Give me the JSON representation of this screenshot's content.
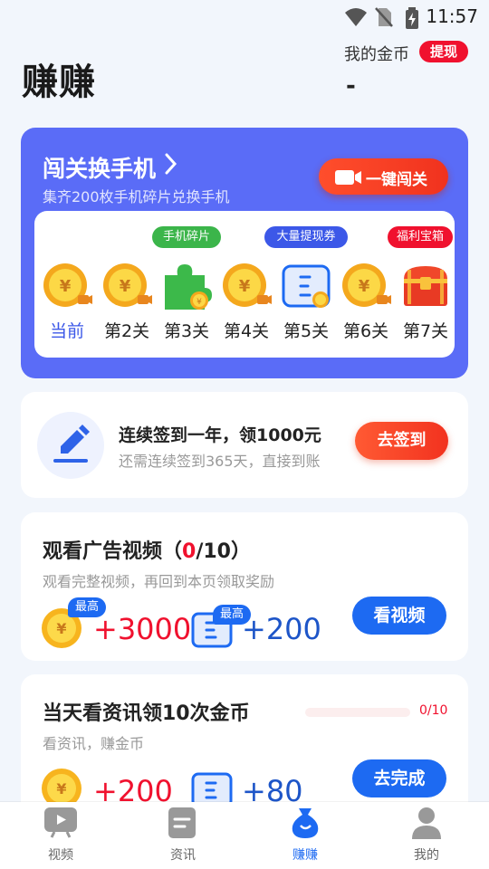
{
  "status_bar": {
    "time": "11:57",
    "icons": [
      "wifi-icon",
      "no-sim-icon",
      "battery-charging-icon"
    ]
  },
  "header": {
    "title": "赚赚",
    "coin_label": "我的金币",
    "withdraw_label": "提现",
    "coin_value": "-"
  },
  "challenge": {
    "title": "闯关换手机",
    "subtitle": "集齐200枚手机碎片兑换手机",
    "one_key_label": "一键闯关",
    "levels": [
      {
        "name": "当前",
        "reward": "coin-icon",
        "current": true
      },
      {
        "name": "第2关",
        "reward": "coin-icon"
      },
      {
        "name": "第3关",
        "reward": "phone-fragment-icon",
        "tag": "手机碎片"
      },
      {
        "name": "第4关",
        "reward": "coin-icon"
      },
      {
        "name": "第5关",
        "reward": "cash-coupon-icon",
        "tag": "大量提现券"
      },
      {
        "name": "第6关",
        "reward": "coin-icon"
      },
      {
        "name": "第7关",
        "reward": "treasure-chest-icon",
        "tag": "福利宝箱"
      }
    ],
    "tag_colors": {
      "手机碎片": "#3BB54A",
      "大量提现券": "#3C58E8",
      "福利宝箱": "#F0112E"
    }
  },
  "sign_in": {
    "title": "连续签到一年，领1000元",
    "subtitle": "还需连续签到365天，直接到账",
    "button": "去签到"
  },
  "video_task": {
    "title_prefix": "观看广告视频（",
    "progress_done": "0",
    "title_suffix": "/10）",
    "subtitle": "观看完整视频，再回到本页领取奖励",
    "coin_badge": "最高",
    "coin_reward": "+3000",
    "coupon_badge": "最高",
    "coupon_reward": "+200",
    "button": "看视频"
  },
  "news_task": {
    "title": "当天看资讯领10次金币",
    "progress_text": "0/10",
    "progress": 0,
    "subtitle": "看资讯，赚金币",
    "coin_reward": "+200",
    "coupon_reward": "+80",
    "button": "去完成"
  },
  "bottom_nav": [
    {
      "label": "视频",
      "icon": "tv-icon"
    },
    {
      "label": "资讯",
      "icon": "document-icon"
    },
    {
      "label": "赚赚",
      "icon": "money-bag-icon",
      "active": true
    },
    {
      "label": "我的",
      "icon": "person-icon"
    }
  ],
  "colors": {
    "accent_blue": "#1D6AF2",
    "card_purple": "#5A6CF7",
    "red": "#F0112E",
    "background": "#F2F6FC"
  }
}
